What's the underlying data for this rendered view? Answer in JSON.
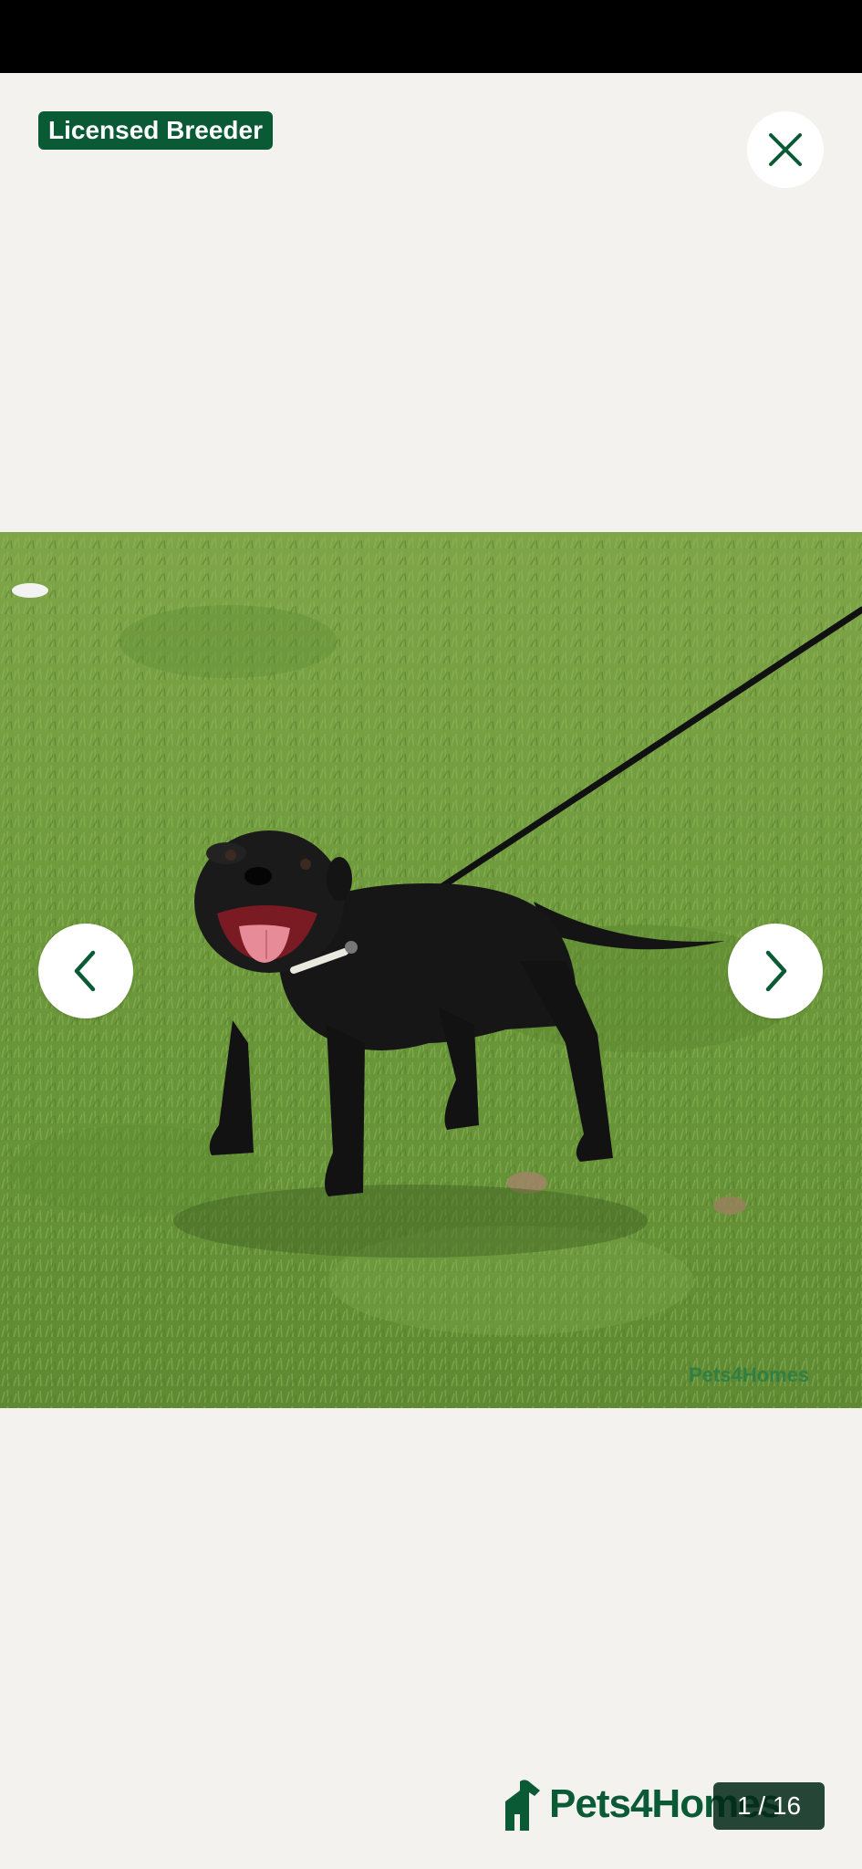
{
  "badge": {
    "label": "Licensed Breeder"
  },
  "close": {
    "icon": "close-icon"
  },
  "gallery": {
    "current": 1,
    "total": 16,
    "counter_text": "1 / 16",
    "prev_icon": "chevron-left-icon",
    "next_icon": "chevron-right-icon",
    "photo_watermark": "Pets4Homes"
  },
  "brand": {
    "name": "Pets4Homes",
    "logo_icon": "pets4homes-logo-icon"
  },
  "colors": {
    "brand_green": "#0b5a36",
    "background": "#f3f2ef",
    "status_bar": "#000000"
  }
}
